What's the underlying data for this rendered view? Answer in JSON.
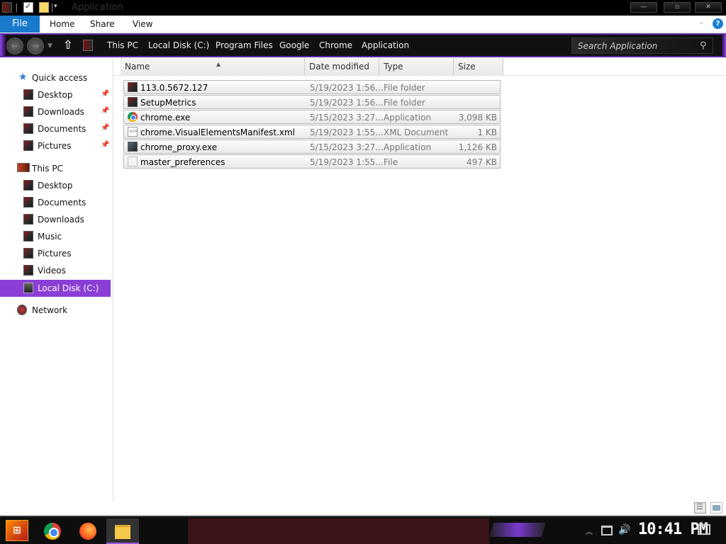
{
  "window": {
    "title": "Application",
    "controls": {
      "minimize": "—",
      "maximize": "▫",
      "close": "✕"
    }
  },
  "ribbon": {
    "tabs": [
      "File",
      "Home",
      "Share",
      "View"
    ],
    "help": "?"
  },
  "address": {
    "breadcrumbs": [
      "This PC",
      "Local Disk (C:)",
      "Program Files",
      "Google",
      "Chrome",
      "Application"
    ],
    "search_placeholder": "Search Application"
  },
  "navpane": {
    "quick_access": {
      "label": "Quick access",
      "items": [
        "Desktop",
        "Downloads",
        "Documents",
        "Pictures"
      ]
    },
    "this_pc": {
      "label": "This PC",
      "items": [
        "Desktop",
        "Documents",
        "Downloads",
        "Music",
        "Pictures",
        "Videos",
        "Local Disk (C:)"
      ]
    },
    "network": {
      "label": "Network"
    }
  },
  "columns": [
    "Name",
    "Date modified",
    "Type",
    "Size"
  ],
  "files": [
    {
      "name": "113.0.5672.127",
      "date": "5/19/2023 1:56...",
      "type": "File folder",
      "size": "",
      "icon": "folder-icon"
    },
    {
      "name": "SetupMetrics",
      "date": "5/19/2023 1:56...",
      "type": "File folder",
      "size": "",
      "icon": "folder-icon"
    },
    {
      "name": "chrome.exe",
      "date": "5/15/2023 3:27...",
      "type": "Application",
      "size": "3,098 KB",
      "icon": "chrome-icon"
    },
    {
      "name": "chrome.VisualElementsManifest.xml",
      "date": "5/19/2023 1:55...",
      "type": "XML Document",
      "size": "1 KB",
      "icon": "xml-file-icon"
    },
    {
      "name": "chrome_proxy.exe",
      "date": "5/15/2023 3:27...",
      "type": "Application",
      "size": "1,126 KB",
      "icon": "application-icon"
    },
    {
      "name": "master_preferences",
      "date": "5/19/2023 1:55...",
      "type": "File",
      "size": "497 KB",
      "icon": "file-icon"
    }
  ],
  "taskbar": {
    "clock": "10:41 PM",
    "pinned": [
      "chrome-icon",
      "firefox-icon",
      "file-explorer-icon"
    ]
  },
  "colors": {
    "accent_purple": "#8a3ed6",
    "file_tab_blue": "#1979ca",
    "titlebar": "#000000"
  }
}
